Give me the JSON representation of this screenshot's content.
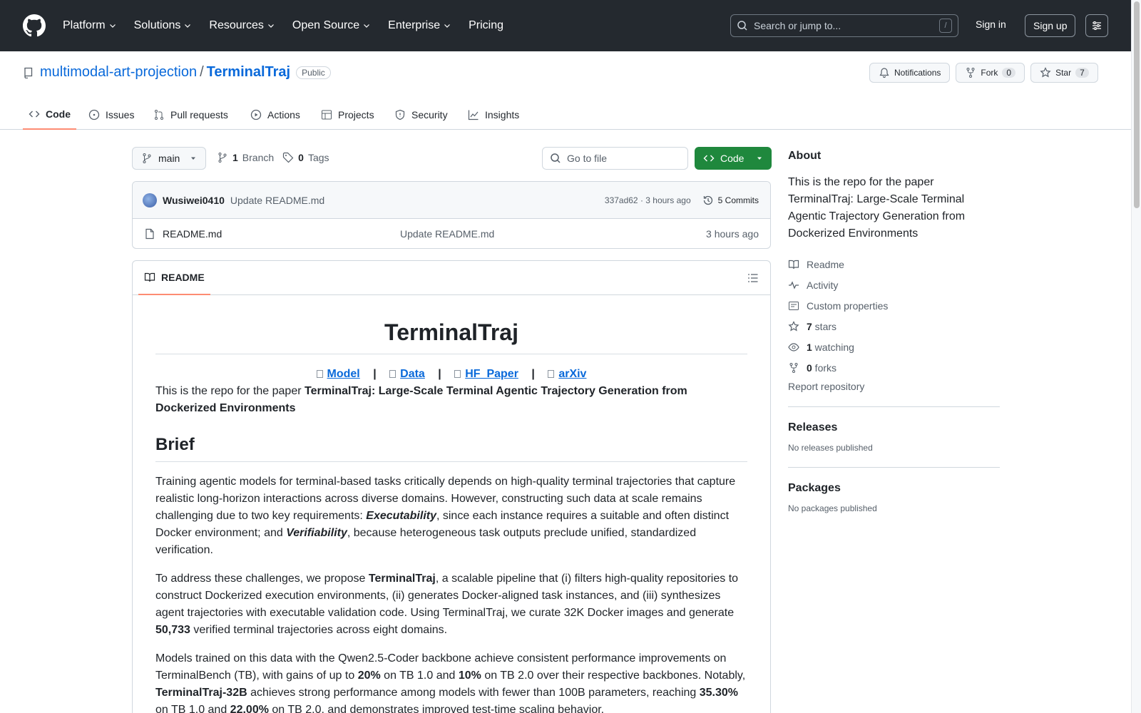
{
  "header": {
    "nav": [
      "Platform",
      "Solutions",
      "Resources",
      "Open Source",
      "Enterprise"
    ],
    "pricing": "Pricing",
    "search_placeholder": "Search or jump to...",
    "search_key": "/",
    "sign_in": "Sign in",
    "sign_up": "Sign up"
  },
  "repo": {
    "owner": "multimodal-art-projection",
    "separator": "/",
    "name": "TerminalTraj",
    "visibility": "Public",
    "notifications": "Notifications",
    "fork_label": "Fork",
    "fork_count": "0",
    "star_label": "Star",
    "star_count": "7"
  },
  "tabs": [
    {
      "label": "Code",
      "icon": "code-icon"
    },
    {
      "label": "Issues",
      "icon": "issue-icon"
    },
    {
      "label": "Pull requests",
      "icon": "pull-request-icon"
    },
    {
      "label": "Actions",
      "icon": "play-icon"
    },
    {
      "label": "Projects",
      "icon": "table-icon"
    },
    {
      "label": "Security",
      "icon": "shield-icon"
    },
    {
      "label": "Insights",
      "icon": "graph-icon"
    }
  ],
  "files": {
    "branch": "main",
    "branch_count": "1",
    "branch_label": "Branch",
    "tag_count": "0",
    "tag_label": "Tags",
    "goto_placeholder": "Go to file",
    "code_button": "Code",
    "commit": {
      "author": "Wusiwei0410",
      "message": "Update README.md",
      "hash_time": "337ad62 · 3 hours ago",
      "commits": "5 Commits"
    },
    "rows": [
      {
        "name": "README.md",
        "message": "Update README.md",
        "time": "3 hours ago"
      }
    ]
  },
  "readme": {
    "tab": "README",
    "title": "TerminalTraj",
    "links": [
      "Model",
      "Data",
      "HF_Paper",
      "arXiv"
    ],
    "link_sep": "|",
    "intro_prefix": "This is the repo for the paper ",
    "intro_bold": "TerminalTraj: Large-Scale Terminal Agentic Trajectory Generation from Dockerized Environments",
    "brief_heading": "Brief",
    "p1": {
      "a": "Training agentic models for terminal-based tasks critically depends on high-quality terminal trajectories that capture realistic long-horizon interactions across diverse domains. However, constructing such data at scale remains challenging due to two key requirements: ",
      "b": "Executability",
      "c": ", since each instance requires a suitable and often distinct Docker environment; and ",
      "d": "Verifiability",
      "e": ", because heterogeneous task outputs preclude unified, standardized verification."
    },
    "p2": {
      "a": "To address these challenges, we propose ",
      "b": "TerminalTraj",
      "c": ", a scalable pipeline that (i) filters high-quality repositories to construct Dockerized execution environments, (ii) generates Docker-aligned task instances, and (iii) synthesizes agent trajectories with executable validation code. Using TerminalTraj, we curate 32K Docker images and generate ",
      "d": "50,733",
      "e": " verified terminal trajectories across eight domains."
    },
    "p3": {
      "a": "Models trained on this data with the Qwen2.5-Coder backbone achieve consistent performance improvements on TerminalBench (TB), with gains of up to ",
      "b": "20%",
      "c": " on TB 1.0 and ",
      "d": "10%",
      "e": " on TB 2.0 over their respective backbones. Notably, ",
      "f": "TerminalTraj-32B",
      "g": " achieves strong performance among models with fewer than 100B parameters, reaching ",
      "h": "35.30%",
      "i": " on TB 1.0 and ",
      "j": "22.00%",
      "k": " on TB 2.0, and demonstrates improved test-time scaling behavior."
    }
  },
  "about": {
    "title": "About",
    "description": "This is the repo for the paper TerminalTraj: Large-Scale Terminal Agentic Trajectory Generation from Dockerized Environments",
    "readme": "Readme",
    "activity": "Activity",
    "custom_properties": "Custom properties",
    "stars_count": "7",
    "stars_label": " stars",
    "watching_count": "1",
    "watching_label": " watching",
    "forks_count": "0",
    "forks_label": " forks",
    "report": "Report repository",
    "releases_title": "Releases",
    "releases_sub": "No releases published",
    "packages_title": "Packages",
    "packages_sub": "No packages published"
  },
  "colors": {
    "header_bg": "#24292f",
    "link": "#0969da",
    "code_button": "#1f883d",
    "tab_underline": "#fd8c73"
  }
}
